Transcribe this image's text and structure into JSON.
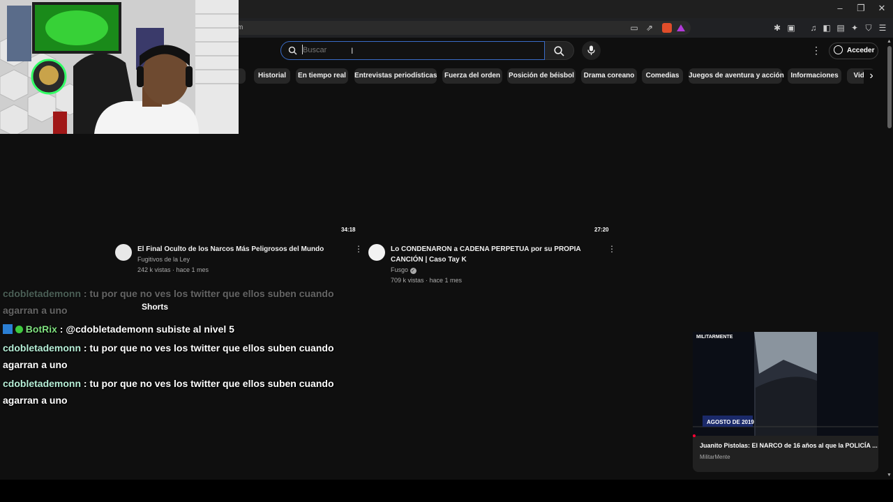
{
  "browser": {
    "url_fragment": "m",
    "window_controls": [
      "–",
      "❐",
      "✕"
    ]
  },
  "header": {
    "search_placeholder": "Buscar",
    "login_label": "Acceder"
  },
  "chips": [
    "ts",
    "Historial",
    "En tiempo real",
    "Entrevistas periodísticas",
    "Fuerza del orden",
    "Posición de béisbol",
    "Drama coreano",
    "Comedias",
    "Juegos de aventura y acción",
    "Informaciones",
    "Vide"
  ],
  "videos": [
    {
      "duration": "34:18",
      "title_line1": "El Final Oculto de los Narcos Más Peligrosos del Mundo",
      "title_line2": "",
      "channel": "Fugitivos de la Ley",
      "meta": "242 k vistas · hace 1 mes"
    },
    {
      "duration": "27:20",
      "title_line1": "Lo CONDENARON a CADENA PERPETUA por su PROPIA",
      "title_line2": "CANCIÓN | Caso Tay K",
      "channel": "Fusgo",
      "meta": "709 k vistas · hace 1 mes"
    }
  ],
  "shorts_label": "Shorts",
  "chat": [
    {
      "user": "cdobletademonn",
      "text_line1": " : tu por que no ves los twitter que ellos suben cuando",
      "text_line2": "agarran a uno"
    },
    {
      "user": "BotRix",
      "text_line1": " : @cdobletademonn subiste al nivel 5",
      "text_line2": ""
    },
    {
      "user": "cdobletademonn",
      "text_line1": " : tu por que no ves los twitter que ellos suben cuando",
      "text_line2": "agarran a uno"
    },
    {
      "user": "cdobletademonn",
      "text_line1": " : tu por que no ves los twitter que ellos suben cuando",
      "text_line2": "agarran a uno"
    }
  ],
  "miniplayer": {
    "brand": "MILITARMENTE",
    "caption": "AGOSTO DE 2019",
    "title": "Juanito Pistolas: El NARCO de 16 años al que la POLICÍA ...",
    "channel": "MilitarMente"
  }
}
